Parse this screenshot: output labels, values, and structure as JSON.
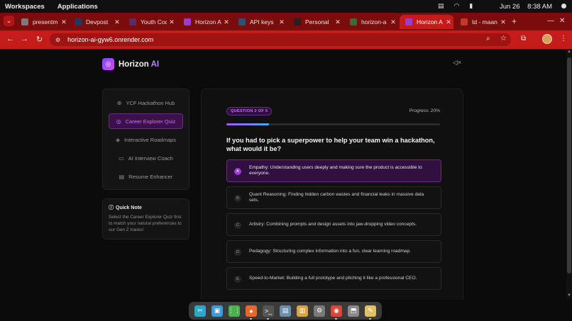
{
  "system_bar": {
    "workspaces": "Workspaces",
    "applications": "Applications",
    "date": "Jun 26",
    "time": "8:38 AM"
  },
  "tabs": [
    {
      "title": "presentm",
      "icon": "clock-icon",
      "color": "#7a7a7a"
    },
    {
      "title": "Devpost",
      "icon": "devpost-icon",
      "color": "#1f3a5f"
    },
    {
      "title": "Youth Cod",
      "icon": "sparkle-icon",
      "color": "#5a2a6a"
    },
    {
      "title": "Horizon A",
      "icon": "horizon-icon",
      "color": "#9b3ad6"
    },
    {
      "title": "API keys",
      "icon": "api-icon",
      "color": "#2d4f7a"
    },
    {
      "title": "Personal",
      "icon": "github-icon",
      "color": "#222222"
    },
    {
      "title": "horizon-a",
      "icon": "render-icon",
      "color": "#3a6a3a"
    },
    {
      "title": "Horizon A",
      "icon": "horizon-icon",
      "color": "#9b3ad6",
      "active": true
    },
    {
      "title": "Id - maan",
      "icon": "gmail-icon",
      "color": "#c0392b"
    }
  ],
  "address_bar": {
    "url": "horizon-ai-gyw6.onrender.com"
  },
  "app": {
    "brand_name": "Horizon",
    "brand_suffix": "AI"
  },
  "sidebar": {
    "items": [
      {
        "label": "YCF Hackathon Hub",
        "icon": "globe-icon",
        "active": false
      },
      {
        "label": "Career Explorer Quiz",
        "icon": "target-icon",
        "active": true
      },
      {
        "label": "Interactive Roadmaps",
        "icon": "layers-icon",
        "active": false
      },
      {
        "label": "AI Interview Coach",
        "icon": "chat-icon",
        "active": false
      },
      {
        "label": "Resume Enhancer",
        "icon": "document-icon",
        "active": false
      }
    ]
  },
  "quick_note": {
    "title": "Quick Note",
    "body": "Select the Career Explorer Quiz first to match your natural preferences to our Gen Z tracks!"
  },
  "quiz": {
    "badge": "QUESTION 2 OF 5",
    "progress_label": "Progress: 20%",
    "progress_fraction": 0.2,
    "question": "If you had to pick a superpower to help your team win a hackathon, what would it be?",
    "options": [
      {
        "letter": "A",
        "text": "Empathy: Understanding users deeply and making sure the product is accessible to everyone.",
        "selected": true
      },
      {
        "letter": "B",
        "text": "Quant Reasoning: Finding hidden carbon wastes and financial leaks in massive data sets.",
        "selected": false
      },
      {
        "letter": "C",
        "text": "Artistry: Combining prompts and design assets into jaw-dropping video concepts.",
        "selected": false
      },
      {
        "letter": "D",
        "text": "Pedagogy: Structuring complex information into a fun, clear learning roadmap.",
        "selected": false
      },
      {
        "letter": "E",
        "text": "Speed-to-Market: Building a full prototype and pitching it like a professional CEO.",
        "selected": false
      }
    ]
  },
  "dock": {
    "apps": [
      {
        "name": "screenshot-app-icon",
        "color": "#2aa7c9",
        "glyph": "✂"
      },
      {
        "name": "image-viewer-icon",
        "color": "#3c9ad6",
        "glyph": "▣"
      },
      {
        "name": "app-grid-icon",
        "color": "#4caf50",
        "glyph": "⋮⋮"
      },
      {
        "name": "firefox-icon",
        "color": "#e8672a",
        "glyph": "●",
        "running": true
      },
      {
        "name": "terminal-icon",
        "color": "#555555",
        "glyph": ">_",
        "running": true
      },
      {
        "name": "files-icon",
        "color": "#6c8fb0",
        "glyph": "▤"
      },
      {
        "name": "file-manager-icon",
        "color": "#d9a441",
        "glyph": "▥"
      },
      {
        "name": "settings-icon",
        "color": "#7a7a7a",
        "glyph": "⚙"
      },
      {
        "name": "chrome-icon",
        "color": "#db4437",
        "glyph": "◉",
        "running": true
      },
      {
        "name": "package-icon",
        "color": "#8a8a8a",
        "glyph": "⬒"
      },
      {
        "name": "text-editor-icon",
        "color": "#e0c060",
        "glyph": "✎",
        "running": true
      }
    ]
  }
}
